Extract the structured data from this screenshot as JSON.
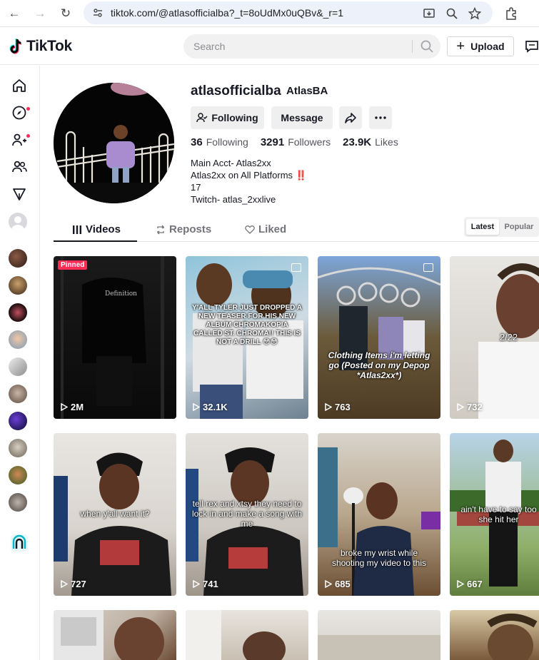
{
  "browser": {
    "url": "tiktok.com/@atlasofficialba?_t=8oUdMx0uQBv&_r=1"
  },
  "header": {
    "logo": "TikTok",
    "search_placeholder": "Search",
    "upload_label": "Upload"
  },
  "profile": {
    "username": "atlasofficialba",
    "nickname": "AtlasBA",
    "following_button": "Following",
    "message_button": "Message",
    "stats": {
      "following_count": "36",
      "following_label": "Following",
      "followers_count": "3291",
      "followers_label": "Followers",
      "likes_count": "23.9K",
      "likes_label": "Likes"
    },
    "bio": [
      "Main Acct- Atlas2xx",
      "Atlas2xx on All Platforms ‼️",
      "17",
      "Twitch- atlas_2xxlive"
    ]
  },
  "tabs": {
    "videos": "Videos",
    "reposts": "Reposts",
    "liked": "Liked"
  },
  "sort": {
    "latest": "Latest",
    "popular": "Popular"
  },
  "videos": [
    {
      "views": "2M",
      "pinned_label": "Pinned",
      "caption": ""
    },
    {
      "views": "32.1K",
      "caption": "Y'ALL TYLER JUST DROPPED A NEW TEASER FOR HIS NEW ALBUM CHROMAKOPIA CALLED ST. CHROMA!! THIS IS NOT A DRILL 😳😳"
    },
    {
      "views": "763",
      "caption": "Clothing Items i'm letting go (Posted on my Depop *Atlas2xx*)"
    },
    {
      "views": "732",
      "caption": "2/22"
    },
    {
      "views": "727",
      "caption": "when y'all want it?"
    },
    {
      "views": "741",
      "caption": "tell rex and xtsy they need to lock in and make a song with me"
    },
    {
      "views": "685",
      "caption": "broke my wrist while shooting my video to this"
    },
    {
      "views": "667",
      "caption": "ain't have to say too she hit her"
    }
  ],
  "colors": {
    "accent": "#fe2c55",
    "text": "#161823"
  }
}
